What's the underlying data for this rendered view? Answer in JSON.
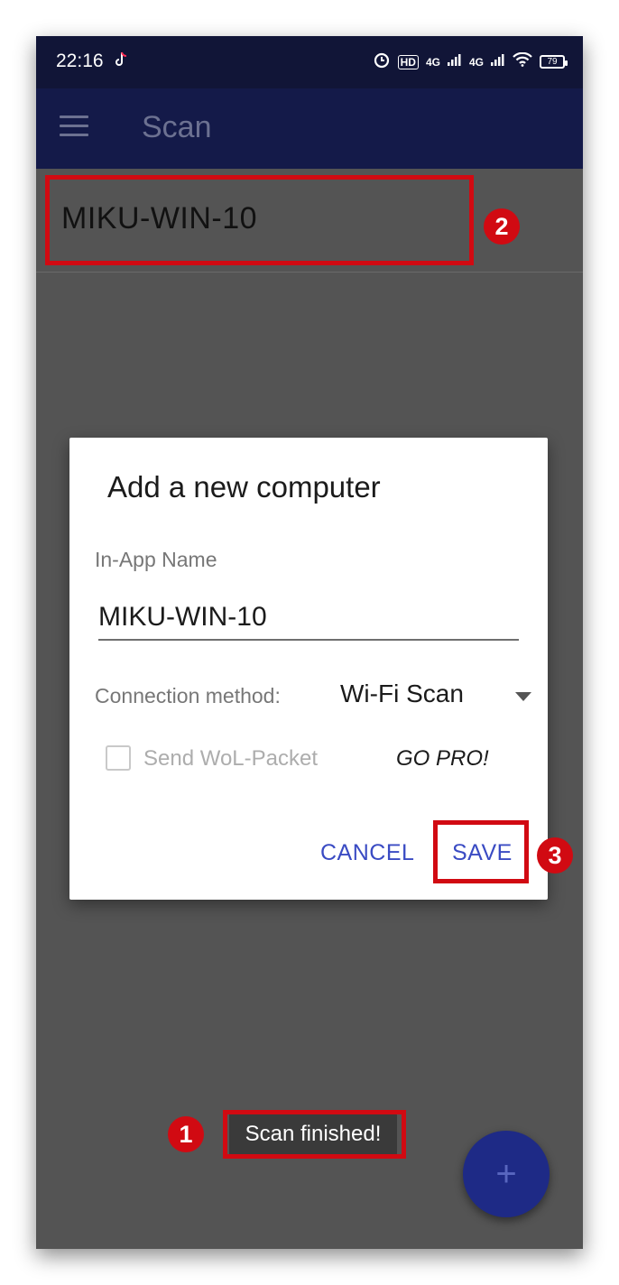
{
  "status_bar": {
    "time": "22:16",
    "hd_badge": "HD",
    "net1": "4G",
    "net2": "4G",
    "battery": "79"
  },
  "app_bar": {
    "title": "Scan",
    "menu_icon": "hamburger-menu-icon"
  },
  "list": {
    "items": [
      {
        "name": "MIKU-WIN-10"
      }
    ]
  },
  "dialog": {
    "title": "Add a new computer",
    "name_label": "In-App Name",
    "name_value": "MIKU-WIN-10",
    "connection_label": "Connection method:",
    "connection_value": "Wi-Fi Scan",
    "wol_label": "Send WoL-Packet",
    "go_pro": "GO PRO!",
    "cancel_label": "CANCEL",
    "save_label": "SAVE"
  },
  "toast": {
    "text": "Scan finished!"
  },
  "fab": {
    "symbol": "+"
  },
  "annotations": [
    "1",
    "2",
    "3"
  ],
  "colors": {
    "app_bar": "#141a49",
    "accent": "#3a4bc3",
    "annotation": "#d10a12",
    "scrim": "#545454"
  }
}
